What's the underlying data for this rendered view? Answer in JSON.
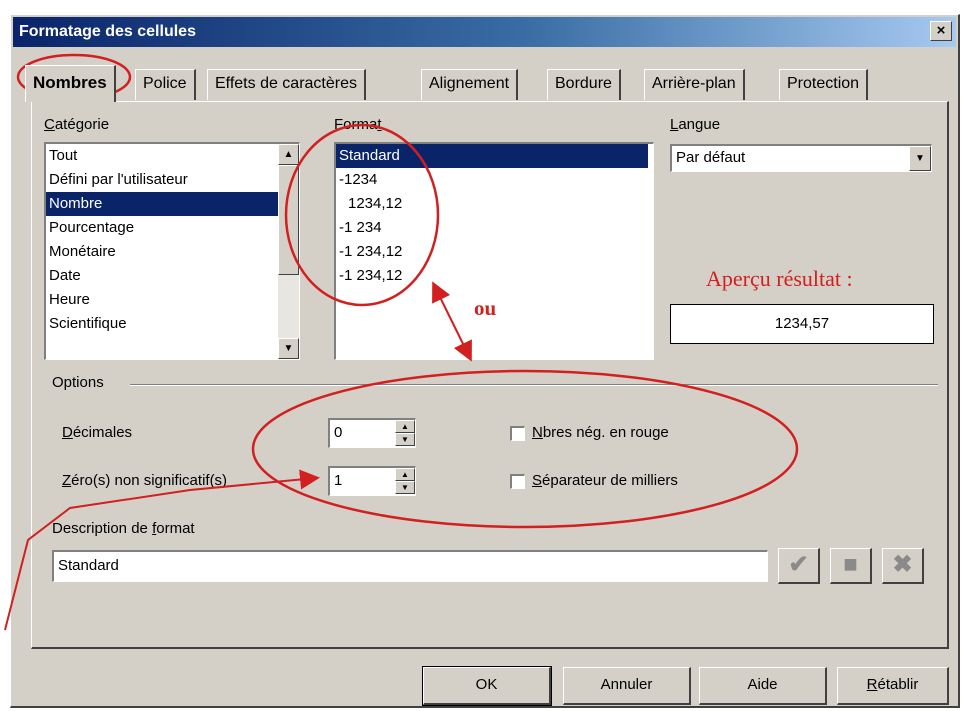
{
  "window": {
    "title": "Formatage des cellules",
    "close_label": "×"
  },
  "tabs": [
    {
      "label": "Nombres",
      "active": true
    },
    {
      "label": "Police"
    },
    {
      "label": "Effets de caractères"
    },
    {
      "label": "Alignement"
    },
    {
      "label": "Bordure"
    },
    {
      "label": "Arrière-plan"
    },
    {
      "label": "Protection"
    }
  ],
  "category": {
    "label_first": "C",
    "label_rest": "atégorie",
    "items": [
      "Tout",
      "Défini par l'utilisateur",
      "Nombre",
      "Pourcentage",
      "Monétaire",
      "Date",
      "Heure",
      "Scientifique"
    ],
    "selected": "Nombre"
  },
  "format": {
    "label_first": "F",
    "label_mid": "orma",
    "label_u": "t",
    "items": [
      "Standard",
      "-1234",
      "1234,12",
      "-1 234",
      "-1 234,12",
      "-1 234,12"
    ],
    "selected": "Standard"
  },
  "language": {
    "label_first": "L",
    "label_rest": "angue",
    "value": "Par défaut"
  },
  "preview": {
    "value": "1234,57"
  },
  "options": {
    "group_label": "Options",
    "decimals": {
      "label_first": "D",
      "label_rest": "écimales",
      "value": "0"
    },
    "leading_zeros": {
      "label_first": "Z",
      "label_rest": "éro(s) non significatif(s)",
      "value": "1"
    },
    "negative_red": {
      "label_first": "N",
      "label_rest": "bres nég. en rouge",
      "checked": false
    },
    "thousands_sep": {
      "label_first": "S",
      "label_rest": "éparateur de milliers",
      "checked": false
    }
  },
  "format_code": {
    "label_start": "Description de ",
    "label_u": "f",
    "label_end": "ormat",
    "value": "Standard"
  },
  "code_buttons": {
    "accept_icon": "check-icon",
    "comment_icon": "comment-icon",
    "delete_icon": "delete-icon"
  },
  "buttons": {
    "ok": "OK",
    "cancel": "Annuler",
    "help": "Aide",
    "reset_first": "R",
    "reset_rest": "établir"
  },
  "annotations": {
    "preview_label": "Aperçu résultat :",
    "or_label": "ou",
    "color": "#d21f1f"
  }
}
